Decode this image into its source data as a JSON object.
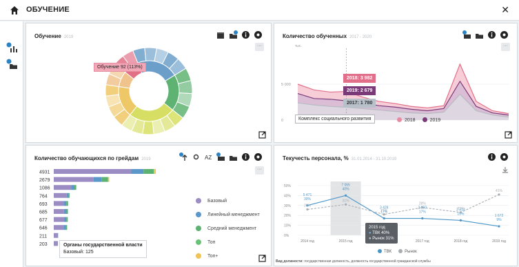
{
  "app": {
    "title": "ОБУЧЕНИЕ"
  },
  "colors": {
    "accent": "#2b83c3",
    "panel_border": "#d4d9de"
  },
  "icons": {
    "home": "home-icon",
    "close": "close-icon",
    "expand": "expand-icon"
  },
  "panel1": {
    "title": "Обучение",
    "subtitle": "2019",
    "tooltip": "Обучение 92 (113%)",
    "chart_data": {
      "type": "sunburst",
      "title": "Обучение",
      "inner_ring": [
        {
          "label": "Обучение",
          "value": 30,
          "color": "#e26f85"
        },
        {
          "label": "",
          "value": 80,
          "color": "#6b9ec9"
        },
        {
          "label": "",
          "value": 70,
          "color": "#5fb372"
        },
        {
          "label": "",
          "value": 90,
          "color": "#d6df63"
        },
        {
          "label": "",
          "value": 60,
          "color": "#eec766"
        },
        {
          "label": "",
          "value": 30,
          "color": "#f0c38d"
        }
      ],
      "outer_ring_segments_per_inner": [
        2,
        5,
        4,
        6,
        4,
        2
      ]
    }
  },
  "panel2": {
    "title": "Количество обученных",
    "subtitle": "2017 - 2020",
    "tooltip_rows": [
      "2018: 3 982",
      "2019: 2 679",
      "2017: 1 780"
    ],
    "hover_label": "Комплекс социального развития",
    "legend": [
      {
        "label": "2018",
        "color": "#e88aa1"
      },
      {
        "label": "2019",
        "color": "#7a3a78"
      }
    ],
    "chart_data": {
      "type": "area",
      "ylabel": "тыс.",
      "yticks": [
        "5 000",
        "0"
      ],
      "ylim": [
        0,
        10000
      ],
      "x": [
        1,
        2,
        3,
        4,
        5,
        6,
        7,
        8,
        9,
        10,
        11,
        12,
        13,
        14
      ],
      "series": [
        {
          "name": "2018",
          "values": [
            5000,
            4200,
            3900,
            3982,
            3200,
            2600,
            2300,
            1900,
            1700,
            2000,
            7800,
            2600,
            1300,
            900
          ]
        },
        {
          "name": "2019",
          "values": [
            3700,
            3000,
            2900,
            2679,
            2400,
            2000,
            1800,
            1500,
            1300,
            1600,
            5400,
            1900,
            1000,
            700
          ]
        },
        {
          "name": "2017",
          "values": [
            2400,
            2100,
            1900,
            1780,
            1600,
            1400,
            1200,
            1000,
            900,
            1100,
            3600,
            1300,
            700,
            400
          ]
        }
      ]
    }
  },
  "panel3": {
    "title": "Количество обучающихся по грейдам",
    "subtitle": "2019",
    "tooltip_title": "Органы государственной власти",
    "tooltip_value": "Базовый: 125",
    "legend": [
      {
        "label": "Базовый",
        "color": "#9b8dc4"
      },
      {
        "label": "Линейный менеджмент",
        "color": "#5b97c9"
      },
      {
        "label": "Средний менеджмент",
        "color": "#5cb270"
      },
      {
        "label": "Топ",
        "color": "#68c276"
      },
      {
        "label": "Топ+",
        "color": "#f0c454"
      }
    ],
    "chart_data": {
      "type": "bar",
      "orientation": "horizontal",
      "categories": [
        "4931",
        "2679",
        "1086",
        "764",
        "693",
        "685",
        "677",
        "646",
        "211",
        "203"
      ],
      "values": [
        4931,
        2679,
        1086,
        764,
        693,
        685,
        677,
        646,
        211,
        203
      ],
      "segments_percent": {
        "Базовый": [
          76,
          72,
          78,
          82,
          70,
          72,
          74,
          74,
          86,
          88
        ],
        "Линейный менеджмент": [
          12,
          14,
          14,
          12,
          18,
          18,
          16,
          16,
          14,
          12
        ],
        "Средний менеджмент": [
          10,
          12,
          8,
          6,
          12,
          10,
          10,
          10,
          0,
          0
        ],
        "Топ+": [
          2,
          2,
          0,
          0,
          0,
          0,
          0,
          0,
          0,
          0
        ]
      }
    }
  },
  "panel4": {
    "title": "Текучесть персонала, %",
    "subtitle": "31.01.2014 - 31.10.2019",
    "tooltip_lines": [
      "2015 год",
      "ТВК 40%",
      "Рынок 31%"
    ],
    "legend": [
      {
        "label": "ТВК",
        "color": "#4b95c8"
      },
      {
        "label": "Рынок",
        "color": "#a8adb2"
      }
    ],
    "footnote_bold": "Вид должности:",
    "footnote": "государственная должность, должность государственной гражданской службы",
    "chart_data": {
      "type": "line",
      "title": "Текучесть персонала, %",
      "categories": [
        "2014 год",
        "2015 год",
        "2016 год",
        "2017 год",
        "2018 год",
        "2019 год"
      ],
      "yticks": [
        "50%",
        "40%",
        "30%",
        "20%",
        "10%",
        "0%"
      ],
      "ylim": [
        0,
        50
      ],
      "series": [
        {
          "name": "ТВК",
          "values": [
            30,
            40,
            17,
            17,
            15,
            9
          ],
          "labels": [
            "5 471\n30%",
            "7 065\n40%",
            "3 428\n17%",
            "2 950\n17%",
            "2 313\n15%",
            "1 672\n9%"
          ]
        },
        {
          "name": "Рынок",
          "values": [
            26,
            31,
            21,
            28,
            23,
            41
          ],
          "labels": [
            "26%",
            "31%",
            "21%",
            "28%",
            "23%",
            "41%"
          ]
        }
      ]
    }
  }
}
